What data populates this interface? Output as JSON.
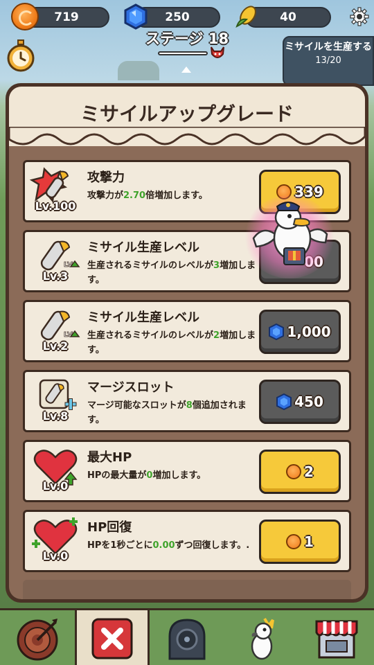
{
  "hud": {
    "coins": "719",
    "gems": "250",
    "corn": "40",
    "icons": [
      "coin-icon",
      "gem-icon",
      "corn-icon",
      "gear-icon"
    ]
  },
  "stage": {
    "title": "ステージ 18"
  },
  "produce": {
    "label": "ミサイルを生産する",
    "count": "13/20"
  },
  "panel": {
    "title": "ミサイルアップグレード"
  },
  "upgrades": [
    {
      "title": "攻撃力",
      "level": "Lv.100",
      "desc_pre": "攻撃力が",
      "desc_value": "2.70",
      "desc_post": "倍増加します。",
      "price": "339",
      "currency": "coin",
      "icon": "attack-missile-icon"
    },
    {
      "title": "ミサイル生産レベル",
      "level": "Lv.3",
      "desc_pre": "生産されるミサイルのレベルが",
      "desc_value": "3",
      "desc_post": "増加します。",
      "price": "00",
      "currency": "gem",
      "icon": "missile-level-up-icon"
    },
    {
      "title": "ミサイル生産レベル",
      "level": "Lv.2",
      "desc_pre": "生産されるミサイルのレベルが",
      "desc_value": "2",
      "desc_post": "増加します。",
      "price": "1,000",
      "currency": "gem",
      "icon": "missile-level-up-icon"
    },
    {
      "title": "マージスロット",
      "level": "Lv.8",
      "desc_pre": "マージ可能なスロットが",
      "desc_value": "8",
      "desc_post": "個追加されます。",
      "price": "450",
      "currency": "gem",
      "icon": "merge-slot-icon"
    },
    {
      "title": "最大HP",
      "level": "Lv.0",
      "desc_pre": "HPの最大量が",
      "desc_value": "0",
      "desc_post": "増加します。",
      "price": "2",
      "currency": "coin",
      "icon": "heart-up-icon"
    },
    {
      "title": "HP回復",
      "level": "Lv.0",
      "desc_pre": "HPを1秒ごとに",
      "desc_value": "0.00",
      "desc_post": "ずつ回復します。.",
      "price": "1",
      "currency": "coin",
      "icon": "heart-regen-icon"
    }
  ],
  "nav": [
    "target-icon",
    "close-icon",
    "vault-icon",
    "cockatoo-icon",
    "shop-icon"
  ],
  "colors": {
    "highlight": "#3fa32b",
    "gold_button": "#f6c93a",
    "gray_button": "#5b5b5b",
    "panel_border": "#4a3226"
  }
}
